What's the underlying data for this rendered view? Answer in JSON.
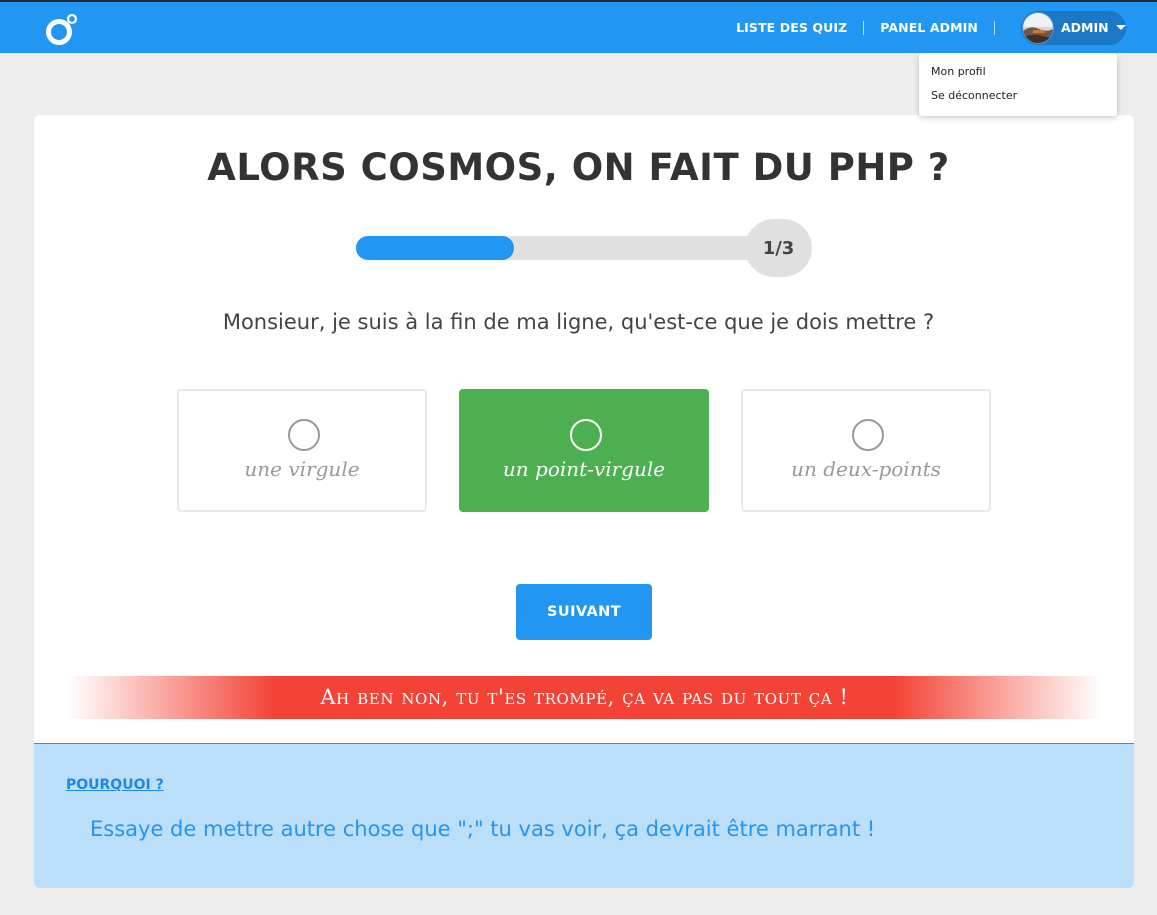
{
  "header": {
    "logo_icon": "logo-icon",
    "nav": {
      "quiz_list": "LISTE DES QUIZ",
      "admin_panel": "PANEL ADMIN"
    },
    "user": {
      "label": "ADMIN",
      "avatar_icon": "avatar-icon",
      "caret_icon": "caret-down-icon"
    },
    "dropdown": {
      "profile": "Mon profil",
      "logout": "Se déconnecter"
    }
  },
  "quiz": {
    "title": "ALORS COSMOS, ON FAIT DU PHP ?",
    "progress": {
      "counter": "1/3",
      "fraction": 0.375
    },
    "question": "Monsieur, je suis à la fin de ma ligne, qu'est-ce que je dois mettre ?",
    "answers": [
      {
        "label": "une virgule",
        "selected": false
      },
      {
        "label": "un point-virgule",
        "selected": true
      },
      {
        "label": "un deux-points",
        "selected": false
      }
    ],
    "next_label": "SUIVANT",
    "feedback": "Ah ben non, tu t'es trompé, ça va pas du tout ça !"
  },
  "explanation": {
    "link_label": "POURQUOI ?",
    "text": "Essaye de mettre autre chose que \";\" tu vas voir, ça devrait être marrant !"
  },
  "colors": {
    "primary": "#2196f3",
    "selected": "#4caf50",
    "error": "#f44336",
    "panel": "#bbdefb"
  }
}
